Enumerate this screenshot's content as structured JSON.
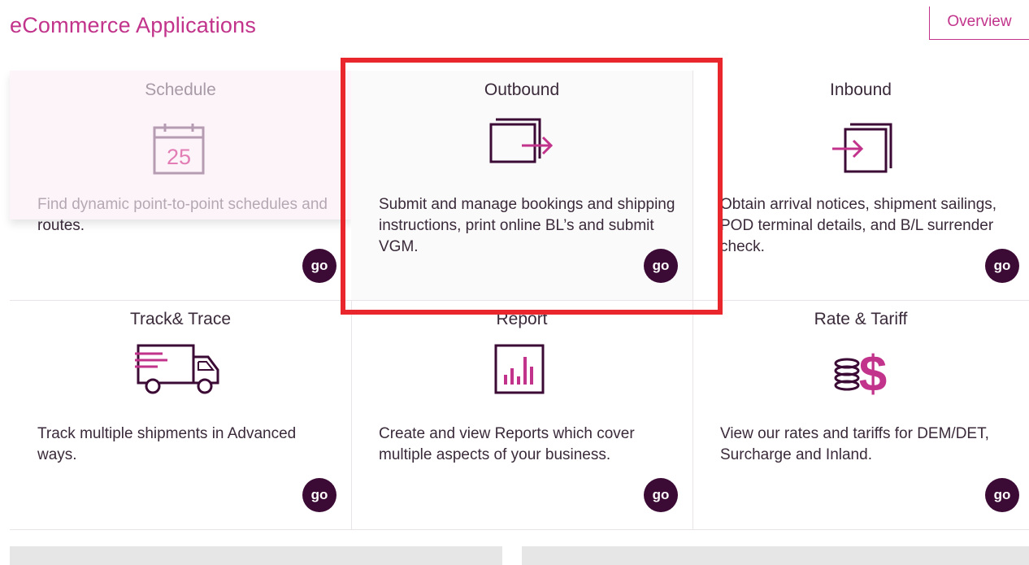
{
  "header": {
    "title": "eCommerce Applications",
    "overview_label": "Overview"
  },
  "tiles": [
    {
      "title": "Schedule",
      "description": "Find dynamic point-to-point schedules and routes.",
      "go": "go",
      "icon": "calendar-icon"
    },
    {
      "title": "Outbound",
      "description": "Submit and manage bookings and shipping instructions, print online BL’s and submit VGM.",
      "go": "go",
      "icon": "outbound-icon"
    },
    {
      "title": "Inbound",
      "description": "Obtain arrival notices, shipment sailings, POD terminal details, and B/L surrender check.",
      "go": "go",
      "icon": "inbound-icon"
    },
    {
      "title": "Track& Trace",
      "description": "Track multiple shipments in Advanced ways.",
      "go": "go",
      "icon": "truck-icon"
    },
    {
      "title": "Report",
      "description": "Create and view Reports which cover multiple aspects of your business.",
      "go": "go",
      "icon": "bar-chart-icon"
    },
    {
      "title": "Rate & Tariff",
      "description": "View our rates and tariffs for DEM/DET, Surcharge and Inland.",
      "go": "go",
      "icon": "dollar-coins-icon"
    }
  ],
  "calendar_day": "25",
  "colors": {
    "accent": "#c2348b",
    "dark": "#3b0a35",
    "highlight": "#e8262b"
  }
}
